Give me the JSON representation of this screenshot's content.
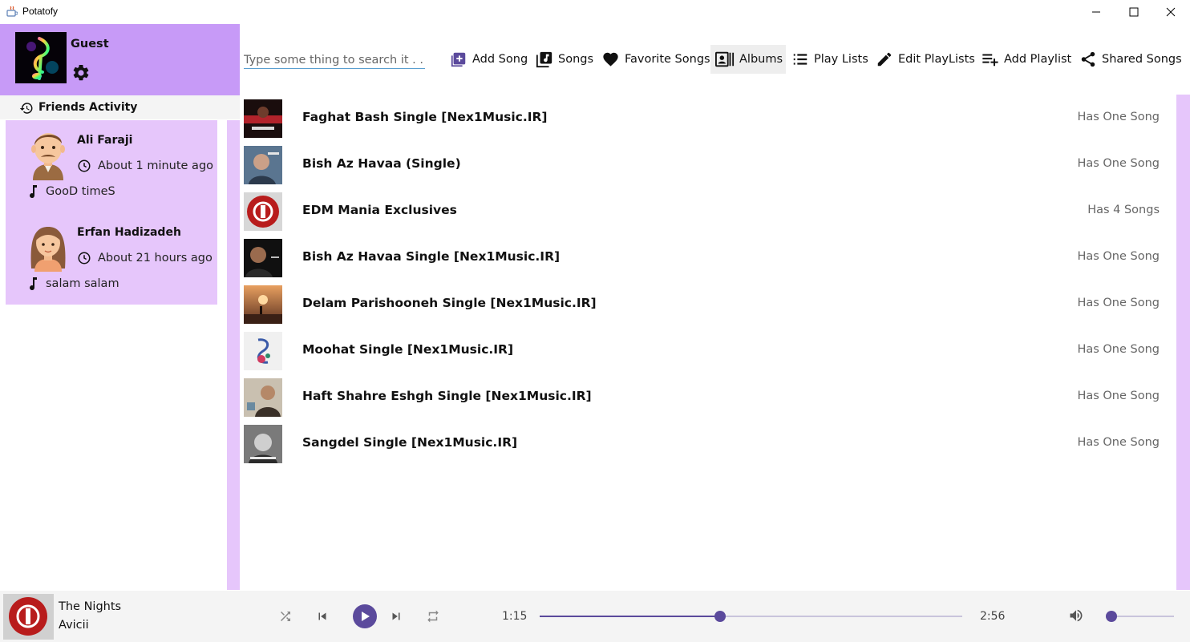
{
  "window": {
    "title": "Potatofy"
  },
  "colors": {
    "accent": "#5b4a9c",
    "sidebar_header": "#c79af7",
    "friend_card": "#e6c6fb",
    "count_text": "#666666"
  },
  "sidebar": {
    "user_name": "Guest",
    "friends_title": "Friends Activity",
    "friends": [
      {
        "name": "Ali Faraji",
        "time": "About 1 minute ago",
        "song": "GooD timeS",
        "avatar": "male-avatar"
      },
      {
        "name": "Erfan Hadizadeh",
        "time": "About 21 hours ago",
        "song": "salam salam",
        "avatar": "female-avatar"
      }
    ]
  },
  "toolbar": {
    "search_placeholder": "Type some thing to search it . . .",
    "buttons": [
      {
        "label": "Add Song",
        "icon": "add-box-icon"
      },
      {
        "label": "Songs",
        "icon": "library-music-icon"
      },
      {
        "label": "Favorite Songs",
        "icon": "heart-icon"
      },
      {
        "label": "Albums",
        "icon": "album-contacts-icon",
        "active": true
      },
      {
        "label": "Play Lists",
        "icon": "list-icon"
      },
      {
        "label": "Edit PlayLists",
        "icon": "pencil-icon"
      },
      {
        "label": "Add Playlist",
        "icon": "playlist-add-icon"
      },
      {
        "label": "Shared Songs",
        "icon": "share-icon"
      }
    ]
  },
  "albums": [
    {
      "title": "Faghat Bash Single [Nex1Music.IR]",
      "count": "Has One Song"
    },
    {
      "title": "Bish Az Havaa (Single)",
      "count": "Has One Song"
    },
    {
      "title": "EDM Mania Exclusives",
      "count": "Has 4 Songs"
    },
    {
      "title": "Bish Az Havaa Single [Nex1Music.IR]",
      "count": "Has One Song"
    },
    {
      "title": "Delam Parishooneh Single [Nex1Music.IR]",
      "count": "Has One Song"
    },
    {
      "title": "Moohat Single [Nex1Music.IR]",
      "count": "Has One Song"
    },
    {
      "title": "Haft Shahre Eshgh Single [Nex1Music.IR]",
      "count": "Has One Song"
    },
    {
      "title": "Sangdel Single [Nex1Music.IR]",
      "count": "Has One Song"
    }
  ],
  "player": {
    "title": "The Nights",
    "artist": "Avicii",
    "current_time": "1:15",
    "total_time": "2:56",
    "progress": 0.427,
    "volume": 0.07
  }
}
